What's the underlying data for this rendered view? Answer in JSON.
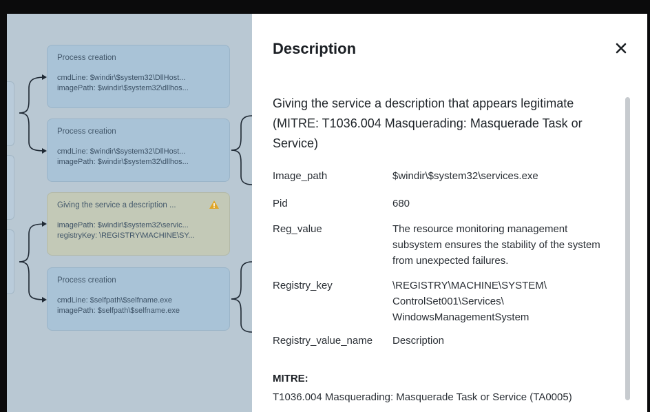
{
  "graph": {
    "nodes": [
      {
        "title": "Process creation",
        "lines": [
          "cmdLine: $windir\\$system32\\DllHost...",
          "imagePath: $windir\\$system32\\dllhos..."
        ],
        "warning": false
      },
      {
        "title": "Process creation",
        "lines": [
          "cmdLine: $windir\\$system32\\DllHost...",
          "imagePath: $windir\\$system32\\dllhos..."
        ],
        "warning": false
      },
      {
        "title": "Giving the service a description ...",
        "lines": [
          "imagePath: $windir\\$system32\\servic...",
          "registryKey: \\REGISTRY\\MACHINE\\SY..."
        ],
        "warning": true
      },
      {
        "title": "Process creation",
        "lines": [
          "cmdLine: $selfpath\\$selfname.exe",
          "imagePath: $selfpath\\$selfname.exe"
        ],
        "warning": false
      }
    ]
  },
  "panel": {
    "title": "Description",
    "close_icon": "close-icon",
    "heading": "Giving the service a description that appears legitimate (MITRE: T1036.004 Masquerading: Masquerade Task or Service)",
    "fields": [
      {
        "key": "Image_path",
        "value": "$windir\\$system32\\services.exe"
      },
      {
        "key": "Pid",
        "value": "680"
      },
      {
        "key": "Reg_value",
        "value": "The resource monitoring management subsystem ensures the stability of the system from unexpected failures."
      },
      {
        "key": "Registry_key",
        "value": "\\REGISTRY\\MACHINE\\SYSTEM\\ ControlSet001\\Services\\ WindowsManagementSystem"
      },
      {
        "key": "Registry_value_name",
        "value": "Description"
      }
    ],
    "mitre_label": "MITRE:",
    "mitre_value": "T1036.004 Masquerading: Masquerade Task or Service (TA0005)"
  },
  "colors": {
    "warning": "#e0a526"
  }
}
